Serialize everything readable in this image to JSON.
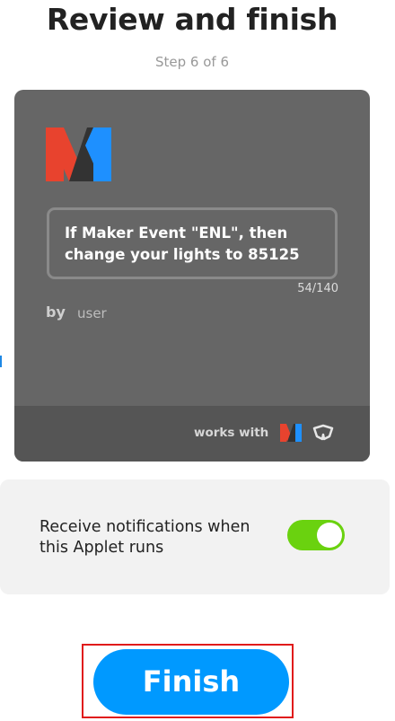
{
  "header": {
    "title": "Review and finish",
    "step": "Step 6 of 6"
  },
  "applet_card": {
    "service_logo_icon": "maker-webhooks-logo",
    "applet_title": "If Maker Event \"ENL\", then change your lights to 85125",
    "char_counter": "54/140",
    "by_label": "by",
    "author": "user",
    "works_with_label": "works with",
    "works_with_icons": [
      "maker-webhooks-logo",
      "yeelight-logo"
    ],
    "colors": {
      "card_bg": "#666666",
      "footer_bg": "#555555",
      "logo_red": "#e8432e",
      "logo_blue": "#1e90ff",
      "logo_dark": "#333333"
    }
  },
  "notifications": {
    "label": "Receive notifications when this Applet runs",
    "enabled": true,
    "toggle_color": "#6ad20f"
  },
  "actions": {
    "finish_label": "Finish",
    "finish_color": "#0099ff",
    "highlight_color": "#e01b1b"
  }
}
